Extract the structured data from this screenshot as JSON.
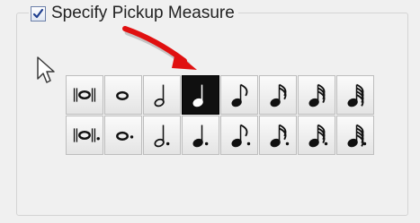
{
  "pickup": {
    "label": "Specify Pickup Measure",
    "checked": true
  },
  "durations": {
    "rows": [
      {
        "dotted": false,
        "items": [
          {
            "name": "breve",
            "icon": "breve-icon",
            "selected": false
          },
          {
            "name": "whole",
            "icon": "whole-note-icon",
            "selected": false
          },
          {
            "name": "half",
            "icon": "half-note-icon",
            "selected": false
          },
          {
            "name": "quarter",
            "icon": "quarter-note-icon",
            "selected": true
          },
          {
            "name": "eighth",
            "icon": "eighth-note-icon",
            "selected": false
          },
          {
            "name": "sixteenth",
            "icon": "sixteenth-note-icon",
            "selected": false
          },
          {
            "name": "thirty-second",
            "icon": "thirty-second-note-icon",
            "selected": false
          },
          {
            "name": "sixty-fourth",
            "icon": "sixty-fourth-note-icon",
            "selected": false
          }
        ]
      },
      {
        "dotted": true,
        "items": [
          {
            "name": "dotted-breve",
            "icon": "dotted-breve-icon",
            "selected": false
          },
          {
            "name": "dotted-whole",
            "icon": "dotted-whole-note-icon",
            "selected": false
          },
          {
            "name": "dotted-half",
            "icon": "dotted-half-note-icon",
            "selected": false
          },
          {
            "name": "dotted-quarter",
            "icon": "dotted-quarter-note-icon",
            "selected": false
          },
          {
            "name": "dotted-eighth",
            "icon": "dotted-eighth-note-icon",
            "selected": false
          },
          {
            "name": "dotted-sixteenth",
            "icon": "dotted-sixteenth-note-icon",
            "selected": false
          },
          {
            "name": "dotted-thirty-second",
            "icon": "dotted-thirty-second-note-icon",
            "selected": false
          },
          {
            "name": "dotted-sixty-fourth",
            "icon": "dotted-sixty-fourth-note-icon",
            "selected": false
          }
        ]
      }
    ]
  },
  "annotation": {
    "arrow_color": "#e01010",
    "arrow_icon": "red-pointer-arrow-icon"
  },
  "colors": {
    "selected_bg": "#101010",
    "glyph": "#111111",
    "checkbox_mark": "#1f3f8f"
  }
}
